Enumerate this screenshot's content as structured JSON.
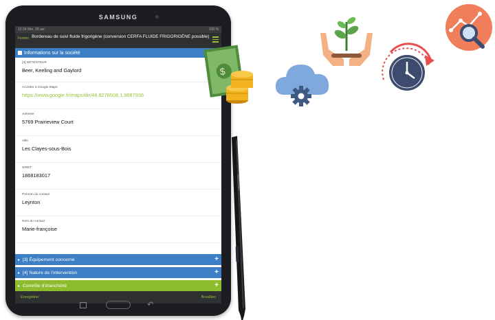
{
  "device": {
    "brand": "SAMSUNG",
    "stylus_brand": "SAMSUNG"
  },
  "status_bar": {
    "left": "12:34 Mer. 28 avr.",
    "right": "100 %"
  },
  "header": {
    "link": "Fermer",
    "title": "Bordereau de suivi fluide frigorigène (conversion CERFA FLUIDE FRIGORIGÈNE possible)"
  },
  "section_open": {
    "label": "Informations sur la société"
  },
  "fields": [
    {
      "label": "[2] DÉTENTEUR",
      "value": "Beer, Keeling and Gaylord"
    },
    {
      "label": "Accéder à Google Maps",
      "value": "https://www.google.fr/maps/dir/48.8276508,1.9687936"
    },
    {
      "label": "Adresse",
      "value": "5769 Prairieview Court"
    },
    {
      "label": "Ville",
      "value": "Les Clayes-sous-Bois"
    },
    {
      "label": "SIRET",
      "value": "1868183017"
    },
    {
      "label": "Prénom du contact",
      "value": "Leynton"
    },
    {
      "label": "Nom du contact",
      "value": "Marie-françoise"
    }
  ],
  "sections_closed": [
    {
      "label": "[3] Équipement concerné",
      "color": "#3d7fc4"
    },
    {
      "label": "[4] Nature de l'intervention",
      "color": "#3d7fc4"
    },
    {
      "label": "Contrôle d'étanchéité",
      "color": "#8dbd2c"
    }
  ],
  "footer": {
    "left": "Enregistrer",
    "right": "Brouillon"
  },
  "colors": {
    "accent_green": "#9cc23c",
    "section_blue": "#3d7fc4",
    "dark_header": "#2f3032"
  },
  "icons": [
    "money-coins-icon",
    "cloud-gear-icon",
    "hands-plant-icon",
    "clock-refresh-icon",
    "analytics-magnifier-icon"
  ]
}
